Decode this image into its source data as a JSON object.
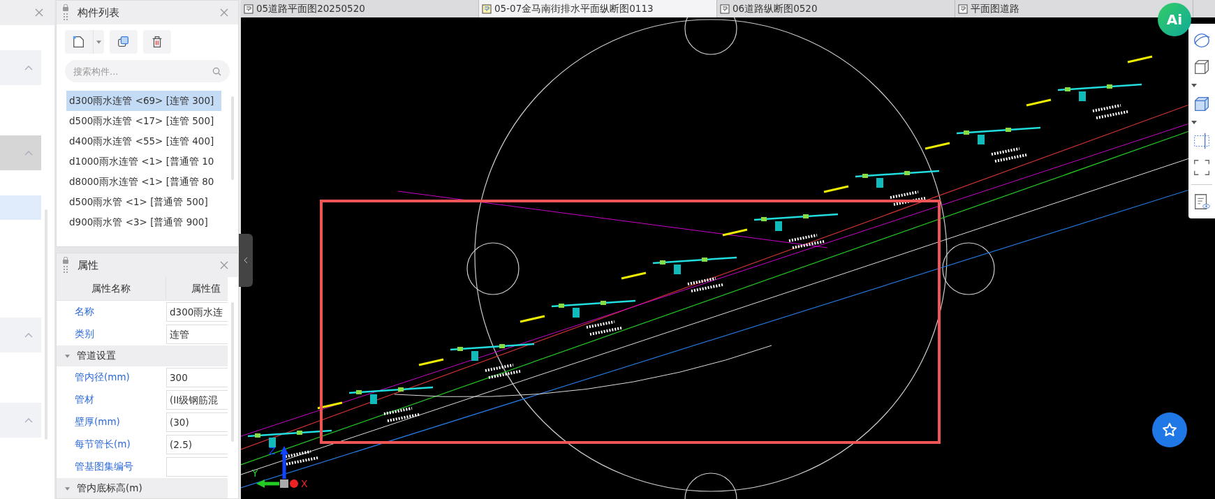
{
  "left_panel": {
    "sections": [
      {
        "kind": "section",
        "expanded": true
      },
      {
        "kind": "section_active",
        "expanded": true
      },
      {
        "kind": "row_selected"
      },
      {
        "kind": "section",
        "expanded": true
      },
      {
        "kind": "section",
        "expanded": true
      }
    ]
  },
  "component_list": {
    "title": "构件列表",
    "search": {
      "placeholder": "搜索构件..."
    },
    "items": [
      {
        "label": "d300雨水连管 <69> [连管 300]",
        "selected": true
      },
      {
        "label": "d500雨水连管 <17> [连管 500]",
        "selected": false
      },
      {
        "label": "d400雨水连管 <55> [连管 400]",
        "selected": false
      },
      {
        "label": "d1000雨水连管 <1> [普通管 10",
        "selected": false
      },
      {
        "label": "d8000雨水连管 <1> [普通管 80",
        "selected": false
      },
      {
        "label": "d500雨水管 <1> [普通管 500]",
        "selected": false
      },
      {
        "label": "d900雨水管 <3> [普通管 900]",
        "selected": false
      }
    ]
  },
  "properties": {
    "title": "属性",
    "columns": [
      "属性名称",
      "属性值"
    ],
    "rows": [
      {
        "kind": "field",
        "name": "名称",
        "value": "d300雨水连"
      },
      {
        "kind": "field",
        "name": "类别",
        "value": "连管"
      },
      {
        "kind": "group",
        "name": "管道设置",
        "expanded": true
      },
      {
        "kind": "field",
        "name": "管内径(mm)",
        "value": "300"
      },
      {
        "kind": "field",
        "name": "管材",
        "value": "(II级钢筋混"
      },
      {
        "kind": "field",
        "name": "壁厚(mm)",
        "value": "(30)"
      },
      {
        "kind": "field",
        "name": "每节管长(m)",
        "value": "(2.5)"
      },
      {
        "kind": "field",
        "name": "管基图集编号",
        "value": ""
      },
      {
        "kind": "group",
        "name": "管内底标高(m)",
        "expanded": true
      }
    ]
  },
  "tabs": [
    {
      "label": "05道路平面图20250520",
      "selected": false
    },
    {
      "label": "05-07金马南街排水平面纵断图0113",
      "selected": true
    },
    {
      "label": "06道路纵断图0520",
      "selected": false
    },
    {
      "label": "平面图道路",
      "selected": false
    }
  ],
  "ai_button": {
    "label": "Ai"
  },
  "axis_gizmo": {
    "x": "X",
    "y": "Y",
    "z": "Z"
  }
}
